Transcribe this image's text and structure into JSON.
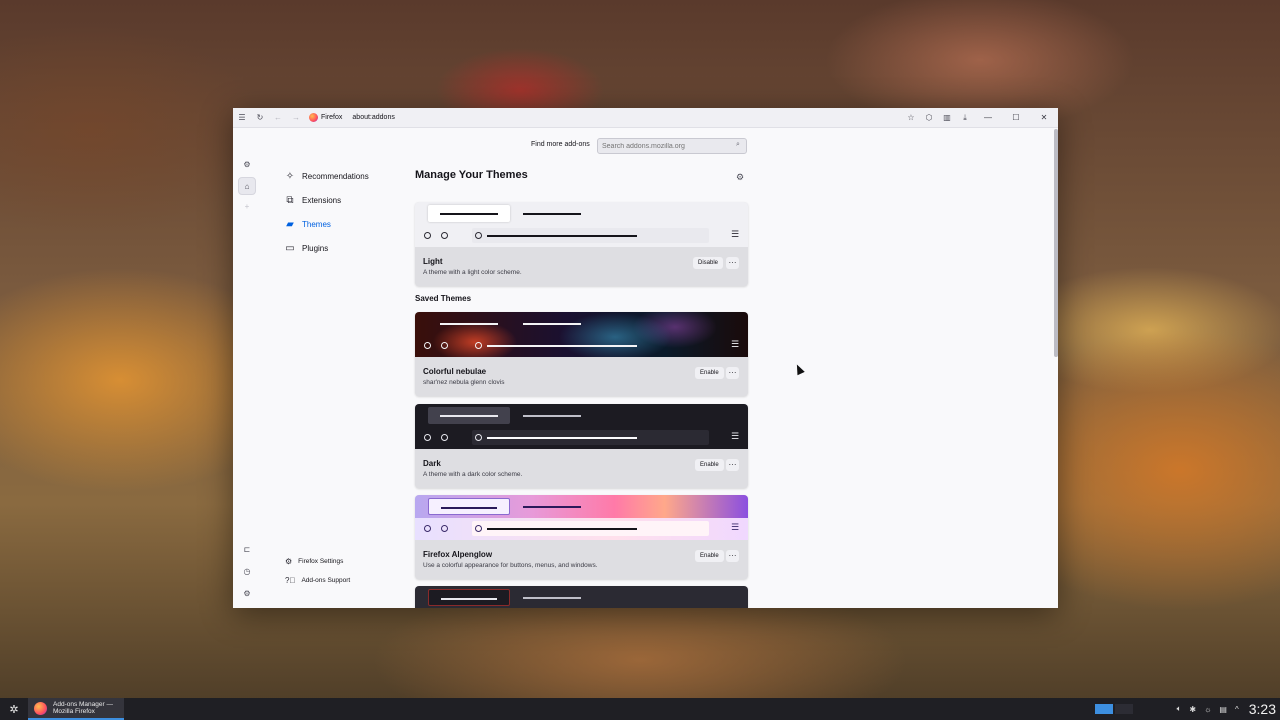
{
  "window": {
    "identity_label": "Firefox",
    "url": "about:addons"
  },
  "search": {
    "label": "Find more add-ons",
    "placeholder": "Search addons.mozilla.org"
  },
  "nav": {
    "items": [
      {
        "label": "Recommendations",
        "icon": "sparkle-icon"
      },
      {
        "label": "Extensions",
        "icon": "puzzle-icon"
      },
      {
        "label": "Themes",
        "icon": "brush-icon",
        "active": true
      },
      {
        "label": "Plugins",
        "icon": "plugin-icon"
      }
    ],
    "footer": [
      {
        "label": "Firefox Settings",
        "icon": "gear-icon"
      },
      {
        "label": "Add-ons Support",
        "icon": "help-icon"
      }
    ]
  },
  "main": {
    "heading": "Manage Your Themes",
    "saved_label": "Saved Themes"
  },
  "themes": {
    "enabled": {
      "name": "Light",
      "description": "A theme with a light color scheme.",
      "button": "Disable"
    },
    "saved": [
      {
        "name": "Colorful nebulae",
        "description": "shar'nez nebula glenn clovis",
        "button": "Enable"
      },
      {
        "name": "Dark",
        "description": "A theme with a dark color scheme.",
        "button": "Enable"
      },
      {
        "name": "Firefox Alpenglow",
        "description": "Use a colorful appearance for buttons, menus, and windows.",
        "button": "Enable"
      }
    ],
    "more_glyph": "···"
  },
  "taskbar": {
    "task_title": "Add-ons Manager —\nMozilla Firefox",
    "clock": "3:23"
  },
  "colors": {
    "accent": "#0061e0",
    "taskbar_accent": "#3d8fe0"
  }
}
